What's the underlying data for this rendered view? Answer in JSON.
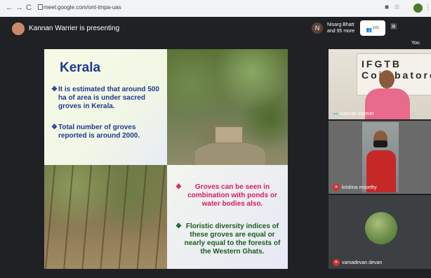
{
  "browser": {
    "url": "meet.google.com/ont-tmpa-uas",
    "back_glyph": "←",
    "forward_glyph": "→",
    "reload_glyph": "C"
  },
  "meet": {
    "presenting_text": "Kannan Warrier is presenting",
    "people": {
      "initial": "N",
      "line1": "Nisarg Bhatt",
      "line2": "and 95 more"
    },
    "participant_count": "101",
    "self_label": "You"
  },
  "slide": {
    "heading": "Kerala",
    "bullets_left": [
      "It is estimated that around 500 ha of area is under sacred groves in Kerala.",
      "Total number of groves reported is around 2000."
    ],
    "bullets_right": [
      "Groves can be seen in combination with ponds or water bodies also.",
      "Floristic diversity indices of these groves are equal or nearly equal to the forests of the Western Ghats."
    ],
    "colors": {
      "heading": "#1f3a93",
      "left_text": "#1f3a93",
      "pink_text": "#d81b60",
      "green_text": "#1b5e20"
    }
  },
  "tiles": [
    {
      "name": "Kannan Warrier",
      "mic": "on",
      "sign_text": "IFGTB Coimbatore"
    },
    {
      "name": "krishna moorthy",
      "mic": "off"
    },
    {
      "name": "vamadevan devan",
      "mic": "off"
    }
  ]
}
